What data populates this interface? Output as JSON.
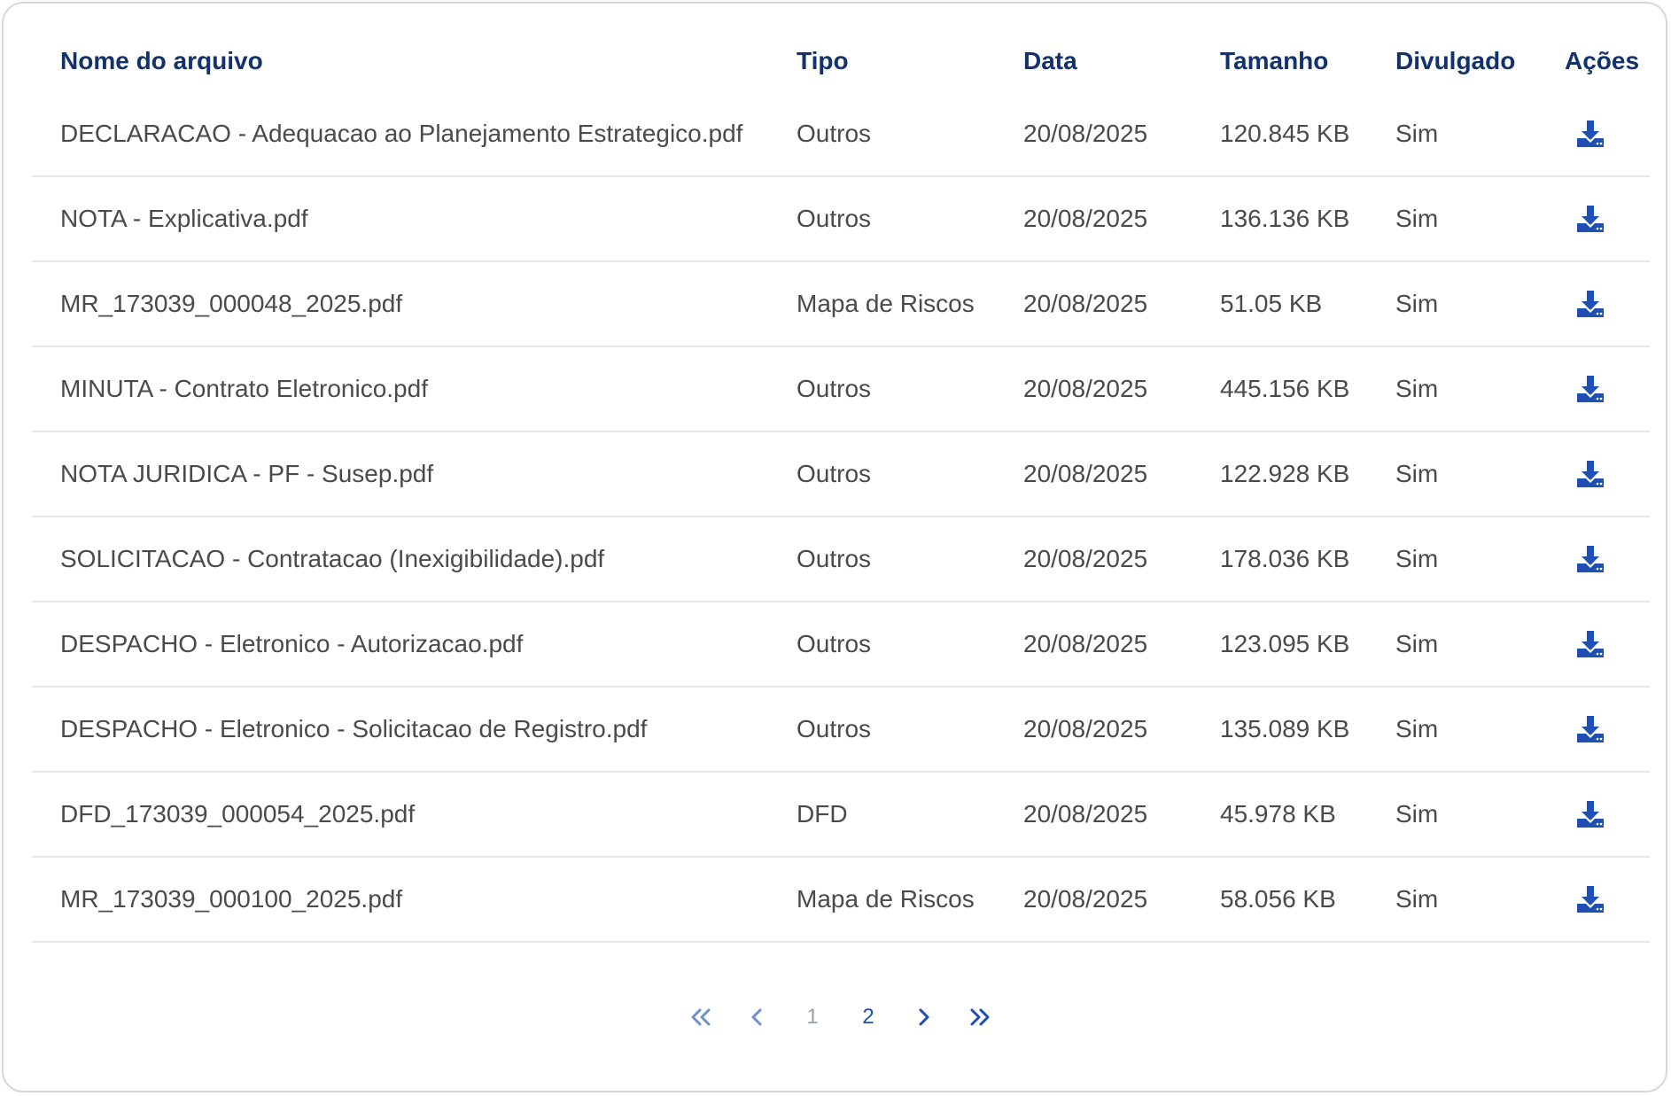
{
  "table": {
    "headers": {
      "name": "Nome do arquivo",
      "tipo": "Tipo",
      "data": "Data",
      "tamanho": "Tamanho",
      "divulgado": "Divulgado",
      "acoes": "Ações"
    },
    "rows": [
      {
        "name": "DECLARACAO - Adequacao ao Planejamento Estrategico.pdf",
        "tipo": "Outros",
        "data": "20/08/2025",
        "tamanho": "120.845 KB",
        "divulgado": "Sim"
      },
      {
        "name": "NOTA - Explicativa.pdf",
        "tipo": "Outros",
        "data": "20/08/2025",
        "tamanho": "136.136 KB",
        "divulgado": "Sim"
      },
      {
        "name": "MR_173039_000048_2025.pdf",
        "tipo": "Mapa de Riscos",
        "data": "20/08/2025",
        "tamanho": "51.05 KB",
        "divulgado": "Sim"
      },
      {
        "name": "MINUTA - Contrato Eletronico.pdf",
        "tipo": "Outros",
        "data": "20/08/2025",
        "tamanho": "445.156 KB",
        "divulgado": "Sim"
      },
      {
        "name": "NOTA JURIDICA - PF - Susep.pdf",
        "tipo": "Outros",
        "data": "20/08/2025",
        "tamanho": "122.928 KB",
        "divulgado": "Sim"
      },
      {
        "name": "SOLICITACAO - Contratacao (Inexigibilidade).pdf",
        "tipo": "Outros",
        "data": "20/08/2025",
        "tamanho": "178.036 KB",
        "divulgado": "Sim"
      },
      {
        "name": "DESPACHO - Eletronico - Autorizacao.pdf",
        "tipo": "Outros",
        "data": "20/08/2025",
        "tamanho": "123.095 KB",
        "divulgado": "Sim"
      },
      {
        "name": "DESPACHO - Eletronico - Solicitacao de Registro.pdf",
        "tipo": "Outros",
        "data": "20/08/2025",
        "tamanho": "135.089 KB",
        "divulgado": "Sim"
      },
      {
        "name": "DFD_173039_000054_2025.pdf",
        "tipo": "DFD",
        "data": "20/08/2025",
        "tamanho": "45.978 KB",
        "divulgado": "Sim"
      },
      {
        "name": "MR_173039_000100_2025.pdf",
        "tipo": "Mapa de Riscos",
        "data": "20/08/2025",
        "tamanho": "58.056 KB",
        "divulgado": "Sim"
      }
    ],
    "row_action_icon": "download-icon"
  },
  "pagination": {
    "first_icon": "double-chevron-left-icon",
    "prev_icon": "chevron-left-icon",
    "pages": [
      "1",
      "2"
    ],
    "current_page": "2",
    "next_icon": "chevron-right-icon",
    "last_icon": "double-chevron-right-icon"
  },
  "colors": {
    "header_text": "#12326e",
    "body_text": "#4a4a4a",
    "accent": "#1f4fb5",
    "accent_light": "#6f8fd0",
    "divider": "#e3e5e8",
    "card_border": "#d6d8dc"
  }
}
